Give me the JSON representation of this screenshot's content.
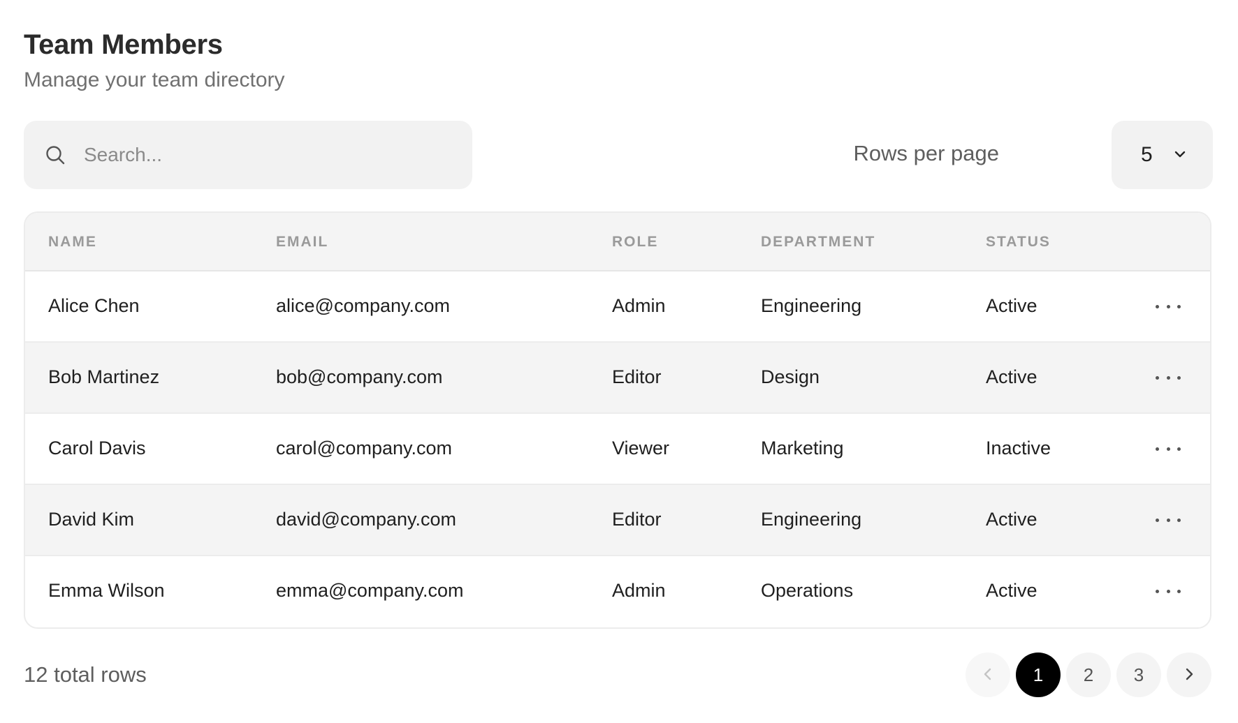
{
  "header": {
    "title": "Team Members",
    "subtitle": "Manage your team directory"
  },
  "search": {
    "placeholder": "Search..."
  },
  "rows_per_page": {
    "label": "Rows per page",
    "value": "5"
  },
  "table": {
    "columns": [
      "NAME",
      "EMAIL",
      "ROLE",
      "DEPARTMENT",
      "STATUS"
    ],
    "rows": [
      {
        "name": "Alice Chen",
        "email": "alice@company.com",
        "role": "Admin",
        "department": "Engineering",
        "status": "Active"
      },
      {
        "name": "Bob Martinez",
        "email": "bob@company.com",
        "role": "Editor",
        "department": "Design",
        "status": "Active"
      },
      {
        "name": "Carol Davis",
        "email": "carol@company.com",
        "role": "Viewer",
        "department": "Marketing",
        "status": "Inactive"
      },
      {
        "name": "David Kim",
        "email": "david@company.com",
        "role": "Editor",
        "department": "Engineering",
        "status": "Active"
      },
      {
        "name": "Emma Wilson",
        "email": "emma@company.com",
        "role": "Admin",
        "department": "Operations",
        "status": "Active"
      }
    ]
  },
  "footer": {
    "total": "12 total rows",
    "pages": [
      "1",
      "2",
      "3"
    ],
    "current_page": "1"
  },
  "icons": {
    "search": "search-icon",
    "dropdown": "chevron-down-icon",
    "row_actions": "more-horizontal-icon",
    "prev": "chevron-left-icon",
    "next": "chevron-right-icon"
  },
  "colors": {
    "accent": "#000000",
    "surface": "#f2f2f2",
    "muted_text": "#707070"
  }
}
